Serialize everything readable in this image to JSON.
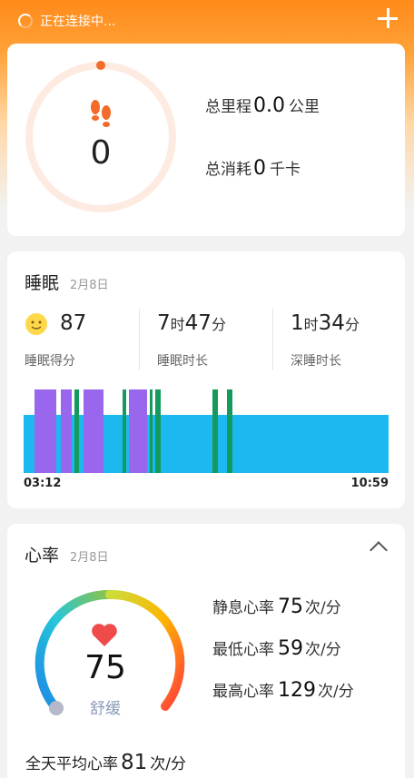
{
  "status": {
    "text": "正在连接中..."
  },
  "steps": {
    "count": "0",
    "distance_label": "总里程",
    "distance_value": "0.0",
    "distance_unit": "公里",
    "calorie_label": "总消耗",
    "calorie_value": "0",
    "calorie_unit": "千卡"
  },
  "sleep": {
    "title": "睡眠",
    "date": "2月8日",
    "score": "87",
    "score_label": "睡眠得分",
    "duration_h": "7",
    "duration_m": "47",
    "hour_unit": "时",
    "minute_unit": "分",
    "duration_label": "睡眠时长",
    "deep_h": "1",
    "deep_m": "34",
    "deep_label": "深睡时长",
    "start_time": "03:12",
    "end_time": "10:59",
    "colors": {
      "light": "#1cb8f0",
      "rem": "#9966ee",
      "awake": "#139a5c"
    }
  },
  "heart": {
    "title": "心率",
    "date": "2月8日",
    "current": "75",
    "state": "舒缓",
    "resting_label": "静息心率",
    "resting_value": "75",
    "min_label": "最低心率",
    "min_value": "59",
    "max_label": "最高心率",
    "max_value": "129",
    "unit": "次/分",
    "avg_label": "全天平均心率",
    "avg_value": "81"
  }
}
